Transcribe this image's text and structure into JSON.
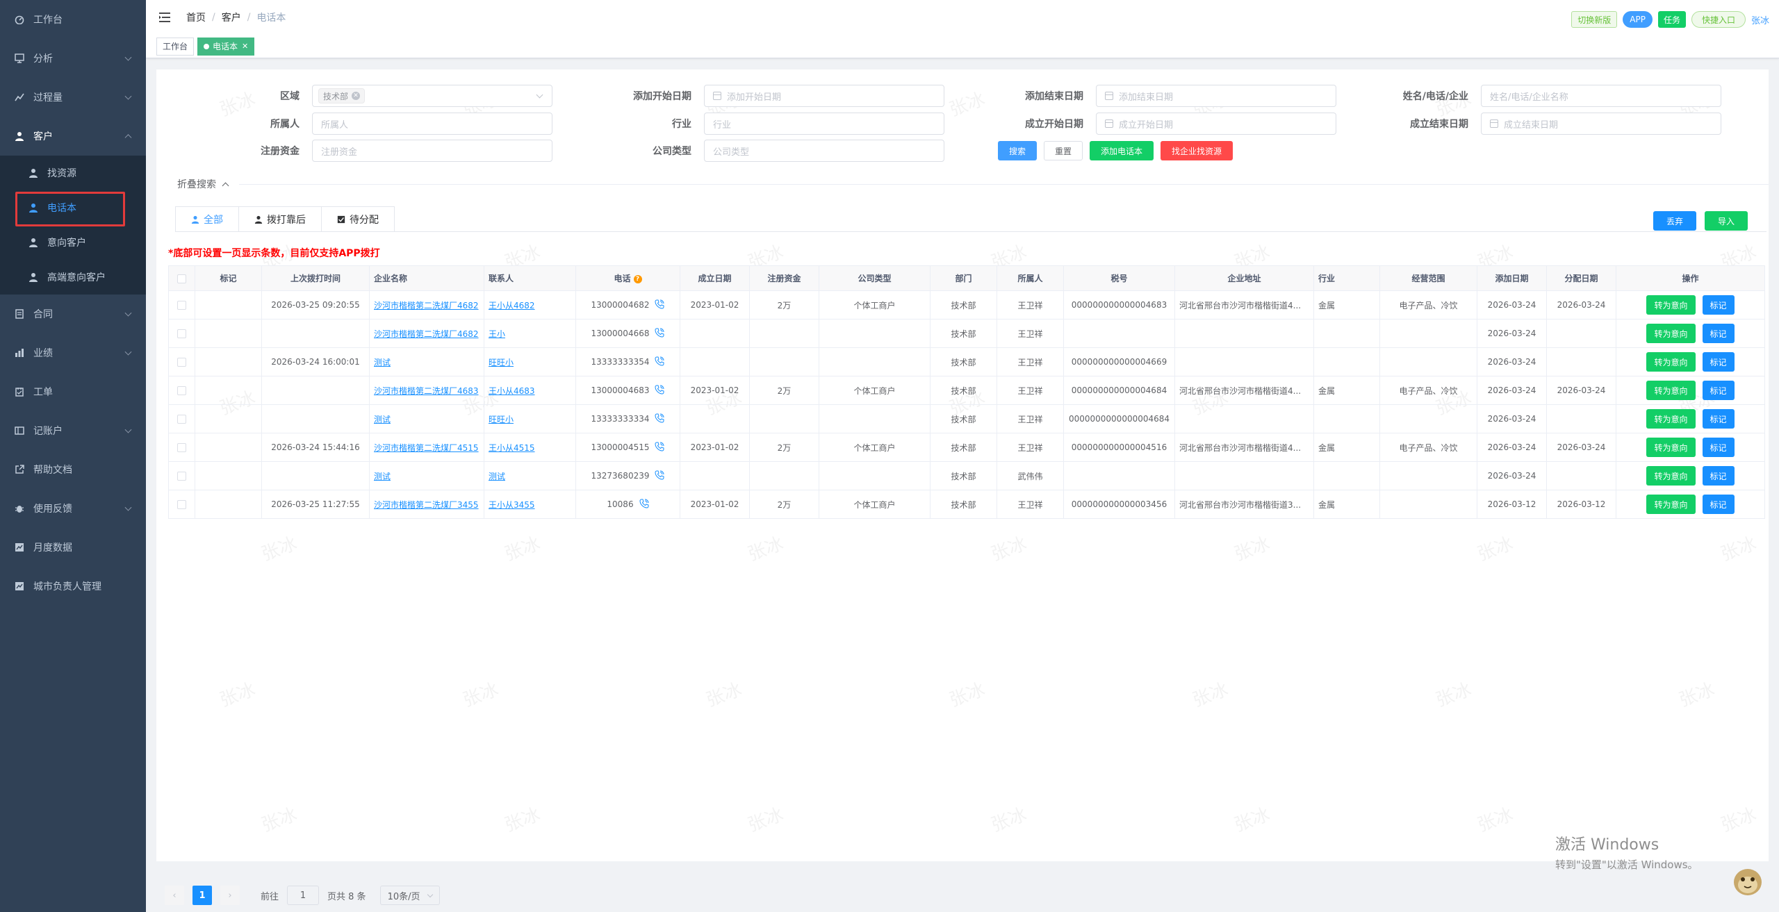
{
  "sidebar": {
    "items": [
      {
        "label": "工作台",
        "icon": "dashboard-icon"
      },
      {
        "label": "分析",
        "icon": "chart-icon"
      },
      {
        "label": "过程量",
        "icon": "process-icon"
      },
      {
        "label": "客户",
        "icon": "user-icon"
      },
      {
        "label": "合同",
        "icon": "contract-icon"
      },
      {
        "label": "业绩",
        "icon": "performance-icon"
      },
      {
        "label": "工单",
        "icon": "ticket-icon"
      },
      {
        "label": "记账户",
        "icon": "account-icon"
      },
      {
        "label": "帮助文档",
        "icon": "external-link-icon"
      },
      {
        "label": "使用反馈",
        "icon": "bug-icon"
      },
      {
        "label": "月度数据",
        "icon": "monthly-icon"
      },
      {
        "label": "城市负责人管理",
        "icon": "city-icon"
      }
    ],
    "customer_sub": [
      {
        "label": "找资源"
      },
      {
        "label": "电话本"
      },
      {
        "label": "意向客户"
      },
      {
        "label": "高端意向客户"
      }
    ]
  },
  "navbar": {
    "breadcrumb": [
      "首页",
      "客户",
      "电话本"
    ],
    "switch_label": "切换新版",
    "app_label": "APP",
    "task_label": "任务",
    "quick_label": "快捷入口",
    "user": "张冰"
  },
  "tags": {
    "workbench": "工作台",
    "current": "电话本"
  },
  "filters": {
    "region_label": "区域",
    "region_value": "技术部",
    "add_start_label": "添加开始日期",
    "add_start_ph": "添加开始日期",
    "add_end_label": "添加结束日期",
    "add_end_ph": "添加结束日期",
    "name_label": "姓名/电话/企业",
    "name_ph": "姓名/电话/企业名称",
    "owner_label": "所属人",
    "owner_ph": "所属人",
    "industry_label": "行业",
    "industry_ph": "行业",
    "est_start_label": "成立开始日期",
    "est_start_ph": "成立开始日期",
    "est_end_label": "成立结束日期",
    "est_end_ph": "成立结束日期",
    "capital_label": "注册资金",
    "capital_ph": "注册资金",
    "company_type_label": "公司类型",
    "company_type_ph": "公司类型",
    "search_btn": "搜索",
    "reset_btn": "重置",
    "add_phone_btn": "添加电话本",
    "find_btn": "找企业找资源",
    "collapse_label": "折叠搜索"
  },
  "tabs": [
    {
      "label": "全部"
    },
    {
      "label": "拨打靠后"
    },
    {
      "label": "待分配"
    }
  ],
  "actions": {
    "abandon": "丢弃",
    "import": "导入"
  },
  "warning": "*底部可设置一页显示条数，目前仅支持APP拨打",
  "table": {
    "columns": [
      "标记",
      "上次拨打时间",
      "企业名称",
      "联系人",
      "电话",
      "成立日期",
      "注册资金",
      "公司类型",
      "部门",
      "所属人",
      "税号",
      "企业地址",
      "行业",
      "经营范围",
      "添加日期",
      "分配日期",
      "操作"
    ],
    "op_intent": "转为意向",
    "op_mark": "标记",
    "rows": [
      {
        "last_call": "2026-03-25 09:20:55",
        "company": "沙河市楷楷第二洗煤厂4682",
        "contact": "王小从4682",
        "phone": "13000004682",
        "est": "2023-01-02",
        "capital": "2万",
        "ctype": "个体工商户",
        "dept": "技术部",
        "owner": "王卫祥",
        "tax": "000000000000004683",
        "addr": "河北省邢台市沙河市楷楷街道4...",
        "industry": "金属",
        "scope": "电子产品、冷饮",
        "added": "2026-03-24",
        "assigned": "2026-03-24"
      },
      {
        "last_call": "",
        "company": "沙河市楷楷第二洗煤厂4682",
        "contact": "王小",
        "phone": "13000004668",
        "est": "",
        "capital": "",
        "ctype": "",
        "dept": "技术部",
        "owner": "王卫祥",
        "tax": "",
        "addr": "",
        "industry": "",
        "scope": "",
        "added": "2026-03-24",
        "assigned": ""
      },
      {
        "last_call": "2026-03-24 16:00:01",
        "company": "测试",
        "contact": "旺旺小",
        "phone": "13333333354",
        "est": "",
        "capital": "",
        "ctype": "",
        "dept": "技术部",
        "owner": "王卫祥",
        "tax": "000000000000004669",
        "addr": "",
        "industry": "",
        "scope": "",
        "added": "2026-03-24",
        "assigned": ""
      },
      {
        "last_call": "",
        "company": "沙河市楷楷第二洗煤厂4683",
        "contact": "王小从4683",
        "phone": "13000004683",
        "est": "2023-01-02",
        "capital": "2万",
        "ctype": "个体工商户",
        "dept": "技术部",
        "owner": "王卫祥",
        "tax": "000000000000004684",
        "addr": "河北省邢台市沙河市楷楷街道4...",
        "industry": "金属",
        "scope": "电子产品、冷饮",
        "added": "2026-03-24",
        "assigned": "2026-03-24"
      },
      {
        "last_call": "",
        "company": "测试",
        "contact": "旺旺小",
        "phone": "13333333334",
        "est": "",
        "capital": "",
        "ctype": "",
        "dept": "技术部",
        "owner": "王卫祥",
        "tax": "0000000000000004684",
        "addr": "",
        "industry": "",
        "scope": "",
        "added": "2026-03-24",
        "assigned": ""
      },
      {
        "last_call": "2026-03-24 15:44:16",
        "company": "沙河市楷楷第二洗煤厂4515",
        "contact": "王小从4515",
        "phone": "13000004515",
        "est": "2023-01-02",
        "capital": "2万",
        "ctype": "个体工商户",
        "dept": "技术部",
        "owner": "王卫祥",
        "tax": "000000000000004516",
        "addr": "河北省邢台市沙河市楷楷街道4...",
        "industry": "金属",
        "scope": "电子产品、冷饮",
        "added": "2026-03-24",
        "assigned": "2026-03-24"
      },
      {
        "last_call": "",
        "company": "测试",
        "contact": "测试",
        "phone": "13273680239",
        "est": "",
        "capital": "",
        "ctype": "",
        "dept": "技术部",
        "owner": "武伟伟",
        "tax": "",
        "addr": "",
        "industry": "",
        "scope": "",
        "added": "2026-03-24",
        "assigned": ""
      },
      {
        "last_call": "2026-03-25 11:27:55",
        "company": "沙河市楷楷第二洗煤厂3455",
        "contact": "王小从3455",
        "phone": "10086",
        "est": "2023-01-02",
        "capital": "2万",
        "ctype": "个体工商户",
        "dept": "技术部",
        "owner": "王卫祥",
        "tax": "000000000000003456",
        "addr": "河北省邢台市沙河市楷楷街道3...",
        "industry": "金属",
        "scope": "",
        "added": "2026-03-12",
        "assigned": "2026-03-12"
      }
    ]
  },
  "pagination": {
    "current": "1",
    "goto_label": "前往",
    "goto_value": "1",
    "total_label": "页共 8 条",
    "page_size": "10条/页"
  },
  "windows_watermark": {
    "line1": "激活 Windows",
    "line2": "转到\"设置\"以激活 Windows。"
  },
  "watermark_text": "张冰"
}
